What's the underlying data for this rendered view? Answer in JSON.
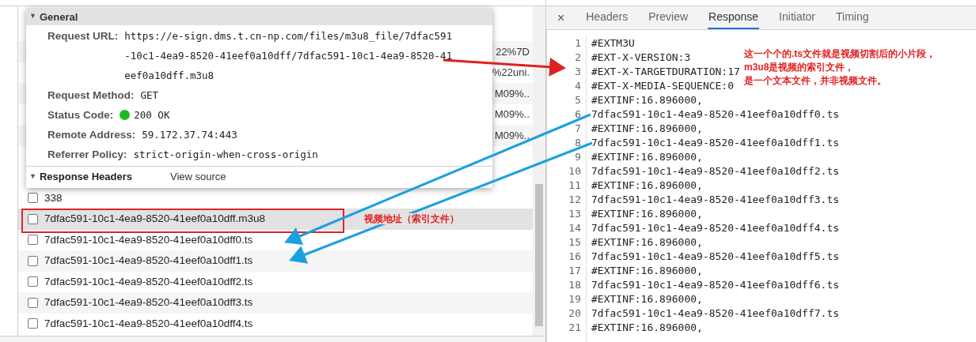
{
  "request_list": {
    "covered_rows": [
      {
        "tail": "22%7D"
      },
      {
        "tail": "%22uni."
      },
      {
        "tail": "M09%.."
      },
      {
        "tail": "M09%.."
      },
      {
        "tail": "M09%.."
      }
    ],
    "files": [
      {
        "name": "338",
        "selected": false
      },
      {
        "name": "7dfac591-10c1-4ea9-8520-41eef0a10dff.m3u8",
        "selected": true
      },
      {
        "name": "7dfac591-10c1-4ea9-8520-41eef0a10dff0.ts",
        "selected": false
      },
      {
        "name": "7dfac591-10c1-4ea9-8520-41eef0a10dff1.ts",
        "selected": false
      },
      {
        "name": "7dfac591-10c1-4ea9-8520-41eef0a10dff2.ts",
        "selected": false
      },
      {
        "name": "7dfac591-10c1-4ea9-8520-41eef0a10dff3.ts",
        "selected": false
      },
      {
        "name": "7dfac591-10c1-4ea9-8520-41eef0a10dff4.ts",
        "selected": false
      }
    ]
  },
  "headers_popover": {
    "caret": "▼",
    "section": "General",
    "fields": [
      {
        "label": "Request URL:",
        "value": "https://e-sign.dms.t.cn-np.com/files/m3u8_file/7dfac591-10c1-4ea9-8520-41eef0a10dff/7dfac591-10c1-4ea9-8520-41eef0a10dff.m3u8",
        "kind": "text"
      },
      {
        "label": "Request Method:",
        "value": "GET",
        "kind": "text"
      },
      {
        "label": "Status Code:",
        "value": "200 OK",
        "kind": "status",
        "color": "#22b822"
      },
      {
        "label": "Remote Address:",
        "value": "59.172.37.74:443",
        "kind": "text"
      },
      {
        "label": "Referrer Policy:",
        "value": "strict-origin-when-cross-origin",
        "kind": "text"
      }
    ],
    "next_section": "Response Headers",
    "view_source": "View source"
  },
  "close_glyph": "×",
  "tabs": [
    {
      "label": "Headers",
      "selected": false
    },
    {
      "label": "Preview",
      "selected": false
    },
    {
      "label": "Response",
      "selected": true
    },
    {
      "label": "Initiator",
      "selected": false
    },
    {
      "label": "Timing",
      "selected": false
    }
  ],
  "code_lines": [
    {
      "number": "1",
      "text": "#EXTM3U"
    },
    {
      "number": "2",
      "text": "#EXT-X-VERSION:3"
    },
    {
      "number": "3",
      "text": "#EXT-X-TARGETDURATION:17"
    },
    {
      "number": "4",
      "text": "#EXT-X-MEDIA-SEQUENCE:0"
    },
    {
      "number": "5",
      "text": "#EXTINF:16.896000,"
    },
    {
      "number": "6",
      "text": "7dfac591-10c1-4ea9-8520-41eef0a10dff0.ts"
    },
    {
      "number": "7",
      "text": "#EXTINF:16.896000,"
    },
    {
      "number": "8",
      "text": "7dfac591-10c1-4ea9-8520-41eef0a10dff1.ts"
    },
    {
      "number": "9",
      "text": "#EXTINF:16.896000,"
    },
    {
      "number": "10",
      "text": "7dfac591-10c1-4ea9-8520-41eef0a10dff2.ts"
    },
    {
      "number": "11",
      "text": "#EXTINF:16.896000,"
    },
    {
      "number": "12",
      "text": "7dfac591-10c1-4ea9-8520-41eef0a10dff3.ts"
    },
    {
      "number": "13",
      "text": "#EXTINF:16.896000,"
    },
    {
      "number": "14",
      "text": "7dfac591-10c1-4ea9-8520-41eef0a10dff4.ts"
    },
    {
      "number": "15",
      "text": "#EXTINF:16.896000,"
    },
    {
      "number": "16",
      "text": "7dfac591-10c1-4ea9-8520-41eef0a10dff5.ts"
    },
    {
      "number": "17",
      "text": "#EXTINF:16.896000,"
    },
    {
      "number": "18",
      "text": "7dfac591-10c1-4ea9-8520-41eef0a10dff6.ts"
    },
    {
      "number": "19",
      "text": "#EXTINF:16.896000,"
    },
    {
      "number": "20",
      "text": "7dfac591-10c1-4ea9-8520-41eef0a10dff7.ts"
    },
    {
      "number": "21",
      "text": "#EXTINF:16.896000,"
    }
  ],
  "annotations": {
    "note_lines": [
      "这一个个的.ts文件就是视频切割后的小片段，",
      "m3u8是视频的索引文件，",
      "是一个文本文件，并非视频文件。"
    ],
    "label": "视频地址（索引文件）"
  }
}
